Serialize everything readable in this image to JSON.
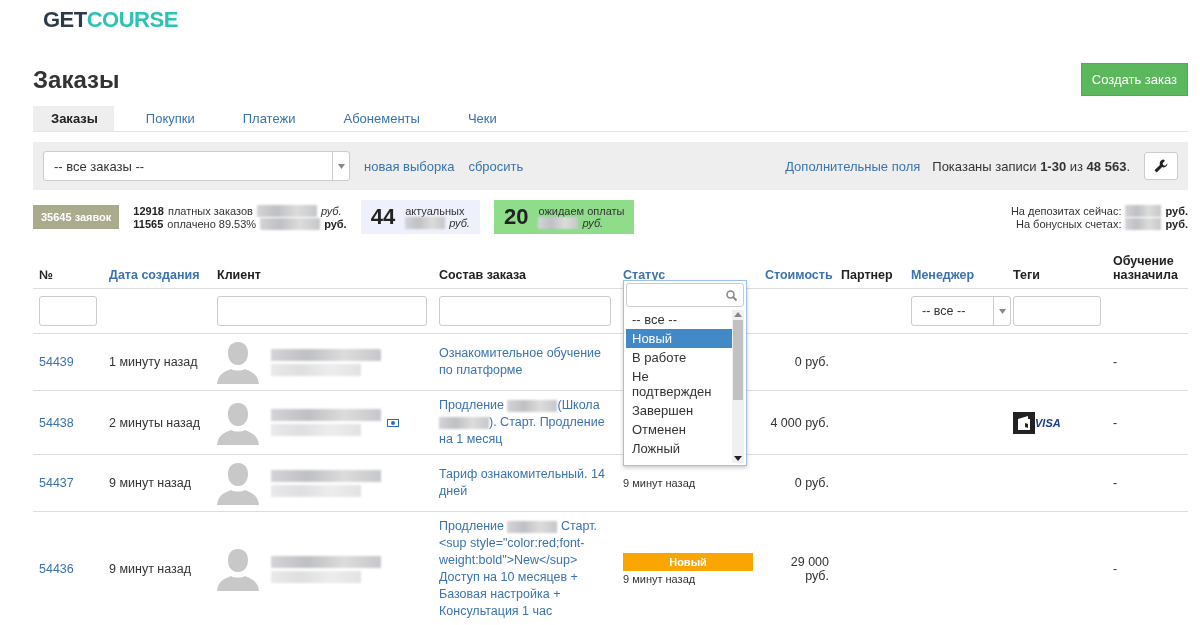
{
  "logo": {
    "first": "GET",
    "second": "COURSE"
  },
  "page_title": "Заказы",
  "create_button": "Создать заказ",
  "tabs": [
    {
      "label": "Заказы",
      "selected": true
    },
    {
      "label": "Покупки",
      "selected": false
    },
    {
      "label": "Платежи",
      "selected": false
    },
    {
      "label": "Абонементы",
      "selected": false
    },
    {
      "label": "Чеки",
      "selected": false
    }
  ],
  "filter_bar": {
    "select_value": "-- все заказы --",
    "links": [
      "новая выборка",
      "сбросить"
    ],
    "extra_fields": "Дополнительные поля",
    "records": "Показаны записи **1-30** из **48 563**."
  },
  "stats": {
    "requests": "35645 заявок",
    "paid": [
      {
        "count": "12918",
        "label": "платных заказов",
        "currency": "руб.",
        "bold": false
      },
      {
        "count": "11565",
        "label": "оплачено 89.53%",
        "currency": "руб.",
        "bold": true
      }
    ],
    "boxes": [
      {
        "kind": "actual",
        "count": "44",
        "label": "актуальных",
        "currency": "руб."
      },
      {
        "kind": "awaiting",
        "count": "20",
        "label": "ожидаем оплаты",
        "currency": "руб."
      }
    ],
    "balances": [
      {
        "label": "На депозитах сейчас:",
        "currency": "руб."
      },
      {
        "label": "На бонусных счетах:",
        "currency": "руб."
      }
    ]
  },
  "table": {
    "columns": [
      {
        "label": "№",
        "sortable": false,
        "filter": {
          "kind": "input"
        }
      },
      {
        "label": "Дата создания",
        "sortable": true
      },
      {
        "label": "Клиент",
        "sortable": false,
        "filter": {
          "kind": "input"
        }
      },
      {
        "label": "Состав заказа",
        "sortable": false,
        "filter": {
          "kind": "input"
        }
      },
      {
        "label": "Статус",
        "sortable": true
      },
      {
        "label": "Стоимость",
        "sortable": true
      },
      {
        "label": "Партнер",
        "sortable": false
      },
      {
        "label": "Менеджер",
        "sortable": true,
        "filter": {
          "kind": "select",
          "value": "-- все --"
        }
      },
      {
        "label": "Теги",
        "sortable": false,
        "filter": {
          "kind": "input"
        }
      },
      {
        "label": "Обучение назначила",
        "sortable": false
      }
    ],
    "rows": [
      {
        "number": "54439",
        "created": "1 минуту назад",
        "client_badge": false,
        "items": [
          {
            "kind": "text",
            "text": "Ознакомительное обучение по платформе"
          }
        ],
        "cost": "0 руб.",
        "tags": [],
        "training": "-"
      },
      {
        "number": "54438",
        "created": "2 минуты назад",
        "client_badge": true,
        "items": [
          {
            "kind": "text",
            "text": "Продление "
          },
          {
            "kind": "redacted"
          },
          {
            "kind": "text",
            "text": "(Школа "
          },
          {
            "kind": "redacted"
          },
          {
            "kind": "text",
            "text": "). Старт. Продление на 1 месяц"
          }
        ],
        "cost": "4 000 руб.",
        "tags": [
          {
            "kind": "card",
            "label": "VISA"
          }
        ],
        "training": "-"
      },
      {
        "number": "54437",
        "created": "9 минут назад",
        "client_badge": false,
        "items": [
          {
            "kind": "text",
            "text": "Тариф ознакомительный. 14 дней"
          }
        ],
        "status": {
          "time": "9 минут назад"
        },
        "cost": "0 руб.",
        "tags": [],
        "training": "-"
      },
      {
        "number": "54436",
        "created": "9 минут назад",
        "client_badge": false,
        "items": [
          {
            "kind": "text",
            "text": "Продление "
          },
          {
            "kind": "redacted"
          },
          {
            "kind": "text",
            "text": " Старт. <sup style=\"color:red;font-weight:bold\">New</sup> Доступ на 10 месяцев + Базовая настройка + Консультация 1 час"
          }
        ],
        "status": {
          "label": "Новый",
          "color": "#f9a602",
          "time": "9 минут назад"
        },
        "cost": "29 000 руб.",
        "tags": [],
        "training": "-"
      }
    ]
  },
  "status_dropdown": {
    "options": [
      {
        "label": "-- все --",
        "selected": false
      },
      {
        "label": "Новый",
        "selected": true
      },
      {
        "label": "В работе",
        "selected": false
      },
      {
        "label": "Не подтвержден",
        "selected": false
      },
      {
        "label": "Завершен",
        "selected": false
      },
      {
        "label": "Отменен",
        "selected": false
      },
      {
        "label": "Ложный",
        "selected": false
      }
    ]
  }
}
